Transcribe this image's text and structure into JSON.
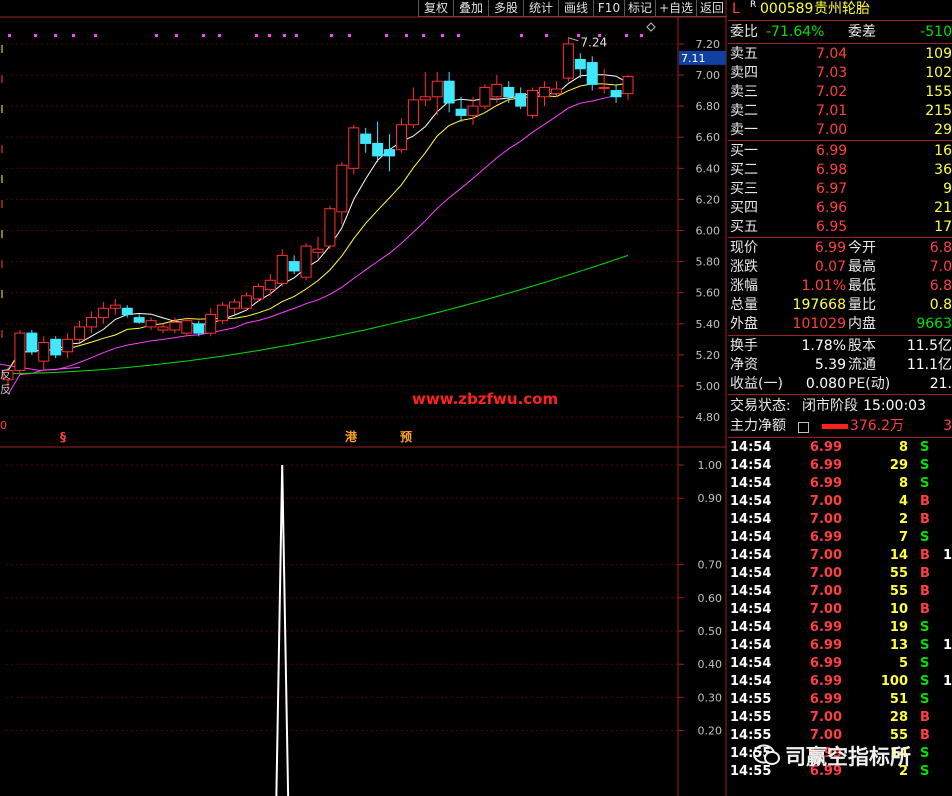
{
  "toolbar": {
    "buttons": [
      "复权",
      "叠加",
      "多股",
      "统计",
      "画线",
      "F10",
      "标记",
      "+自选",
      "返回"
    ]
  },
  "colors": {
    "up": "#ff3030",
    "down": "#40e8ff",
    "ma5": "#ffffff",
    "ma10": "#ffff40",
    "ma20": "#ff40ff",
    "ma60": "#00e000",
    "axis": "#a02020"
  },
  "price_chart": {
    "y_ticks": [
      "7.20",
      "7.00",
      "6.80",
      "6.60",
      "6.40",
      "6.20",
      "6.00",
      "5.80",
      "5.60",
      "5.40",
      "5.20",
      "5.00",
      "4.80"
    ],
    "current_price_tag": "7.11",
    "high_annotation": "7.24",
    "website": "www.zbzfwu.com",
    "markers": [
      "§",
      "港",
      "预"
    ],
    "left_labels": [
      "反",
      "反"
    ],
    "left_marker": "0"
  },
  "chart_data": [
    {
      "type": "candlestick",
      "title": "",
      "ylim": [
        4.7,
        7.3
      ],
      "candles": [
        {
          "o": 5.04,
          "h": 5.12,
          "l": 4.98,
          "c": 5.1
        },
        {
          "o": 5.1,
          "h": 5.36,
          "l": 5.08,
          "c": 5.34
        },
        {
          "o": 5.34,
          "h": 5.36,
          "l": 5.2,
          "c": 5.22
        },
        {
          "o": 5.16,
          "h": 5.32,
          "l": 5.1,
          "c": 5.28
        },
        {
          "o": 5.3,
          "h": 5.32,
          "l": 5.18,
          "c": 5.2
        },
        {
          "o": 5.22,
          "h": 5.34,
          "l": 5.18,
          "c": 5.3
        },
        {
          "o": 5.3,
          "h": 5.42,
          "l": 5.28,
          "c": 5.38
        },
        {
          "o": 5.38,
          "h": 5.48,
          "l": 5.34,
          "c": 5.44
        },
        {
          "o": 5.44,
          "h": 5.54,
          "l": 5.4,
          "c": 5.5
        },
        {
          "o": 5.5,
          "h": 5.56,
          "l": 5.46,
          "c": 5.52
        },
        {
          "o": 5.5,
          "h": 5.52,
          "l": 5.44,
          "c": 5.46
        },
        {
          "o": 5.44,
          "h": 5.46,
          "l": 5.4,
          "c": 5.41
        },
        {
          "o": 5.38,
          "h": 5.44,
          "l": 5.36,
          "c": 5.42
        },
        {
          "o": 5.36,
          "h": 5.4,
          "l": 5.34,
          "c": 5.38
        },
        {
          "o": 5.36,
          "h": 5.44,
          "l": 5.34,
          "c": 5.41
        },
        {
          "o": 5.34,
          "h": 5.44,
          "l": 5.32,
          "c": 5.42
        },
        {
          "o": 5.4,
          "h": 5.42,
          "l": 5.32,
          "c": 5.34
        },
        {
          "o": 5.34,
          "h": 5.5,
          "l": 5.32,
          "c": 5.46
        },
        {
          "o": 5.42,
          "h": 5.54,
          "l": 5.4,
          "c": 5.52
        },
        {
          "o": 5.5,
          "h": 5.56,
          "l": 5.46,
          "c": 5.54
        },
        {
          "o": 5.5,
          "h": 5.6,
          "l": 5.48,
          "c": 5.58
        },
        {
          "o": 5.56,
          "h": 5.66,
          "l": 5.54,
          "c": 5.64
        },
        {
          "o": 5.62,
          "h": 5.72,
          "l": 5.58,
          "c": 5.68
        },
        {
          "o": 5.66,
          "h": 5.88,
          "l": 5.64,
          "c": 5.84
        },
        {
          "o": 5.8,
          "h": 5.84,
          "l": 5.72,
          "c": 5.74
        },
        {
          "o": 5.7,
          "h": 5.92,
          "l": 5.68,
          "c": 5.9
        },
        {
          "o": 5.86,
          "h": 5.96,
          "l": 5.82,
          "c": 5.88
        },
        {
          "o": 5.9,
          "h": 6.16,
          "l": 5.88,
          "c": 6.14
        },
        {
          "o": 6.12,
          "h": 6.44,
          "l": 6.04,
          "c": 6.42
        },
        {
          "o": 6.4,
          "h": 6.68,
          "l": 6.36,
          "c": 6.66
        },
        {
          "o": 6.62,
          "h": 6.66,
          "l": 6.5,
          "c": 6.56
        },
        {
          "o": 6.56,
          "h": 6.7,
          "l": 6.44,
          "c": 6.48
        },
        {
          "o": 6.52,
          "h": 6.62,
          "l": 6.38,
          "c": 6.48
        },
        {
          "o": 6.52,
          "h": 6.72,
          "l": 6.5,
          "c": 6.68
        },
        {
          "o": 6.68,
          "h": 6.92,
          "l": 6.66,
          "c": 6.84
        },
        {
          "o": 6.84,
          "h": 7.02,
          "l": 6.8,
          "c": 6.86
        },
        {
          "o": 6.86,
          "h": 7.02,
          "l": 6.74,
          "c": 6.96
        },
        {
          "o": 6.96,
          "h": 7.02,
          "l": 6.76,
          "c": 6.82
        },
        {
          "o": 6.78,
          "h": 6.86,
          "l": 6.7,
          "c": 6.74
        },
        {
          "o": 6.74,
          "h": 6.86,
          "l": 6.68,
          "c": 6.8
        },
        {
          "o": 6.8,
          "h": 6.94,
          "l": 6.78,
          "c": 6.92
        },
        {
          "o": 6.86,
          "h": 7.0,
          "l": 6.82,
          "c": 6.94
        },
        {
          "o": 6.92,
          "h": 6.96,
          "l": 6.82,
          "c": 6.86
        },
        {
          "o": 6.88,
          "h": 6.92,
          "l": 6.78,
          "c": 6.8
        },
        {
          "o": 6.74,
          "h": 6.92,
          "l": 6.72,
          "c": 6.9
        },
        {
          "o": 6.86,
          "h": 6.96,
          "l": 6.8,
          "c": 6.92
        },
        {
          "o": 6.88,
          "h": 6.96,
          "l": 6.86,
          "c": 6.91
        },
        {
          "o": 6.98,
          "h": 7.24,
          "l": 6.96,
          "c": 7.2
        },
        {
          "o": 7.1,
          "h": 7.14,
          "l": 6.98,
          "c": 7.04
        },
        {
          "o": 7.08,
          "h": 7.12,
          "l": 6.9,
          "c": 6.94
        },
        {
          "o": 6.92,
          "h": 7.04,
          "l": 6.88,
          "c": 6.92
        },
        {
          "o": 6.9,
          "h": 6.94,
          "l": 6.82,
          "c": 6.86
        },
        {
          "o": 6.88,
          "h": 7.0,
          "l": 6.84,
          "c": 6.99
        }
      ]
    },
    {
      "type": "line",
      "title": "",
      "ylim": [
        0,
        1.05
      ],
      "y_ticks": [
        "1.00",
        "0.90",
        "0.70",
        "0.60",
        "0.50",
        "0.40",
        "0.30",
        "0.20"
      ],
      "x": [
        0,
        22.5,
        23,
        23.5,
        25.5
      ],
      "y": [
        0,
        0,
        1.0,
        0,
        0
      ]
    }
  ],
  "quote": {
    "header": {
      "market_l": "L",
      "market_r": "R",
      "code": "000589",
      "name": "贵州轮胎"
    },
    "ratio": {
      "label1": "委比",
      "value1": "-71.64%",
      "label2": "委差",
      "value2": "-510"
    },
    "sells": [
      {
        "label": "卖五",
        "price": "7.04",
        "vol": "109"
      },
      {
        "label": "卖四",
        "price": "7.03",
        "vol": "102"
      },
      {
        "label": "卖三",
        "price": "7.02",
        "vol": "155"
      },
      {
        "label": "卖二",
        "price": "7.01",
        "vol": "215"
      },
      {
        "label": "卖一",
        "price": "7.00",
        "vol": "29"
      }
    ],
    "buys": [
      {
        "label": "买一",
        "price": "6.99",
        "vol": "16"
      },
      {
        "label": "买二",
        "price": "6.98",
        "vol": "36"
      },
      {
        "label": "买三",
        "price": "6.97",
        "vol": "9"
      },
      {
        "label": "买四",
        "price": "6.96",
        "vol": "21"
      },
      {
        "label": "买五",
        "price": "6.95",
        "vol": "17"
      }
    ],
    "stats": [
      {
        "l1": "现价",
        "v1": "6.99",
        "c1": "red",
        "l2": "今开",
        "v2": "6.8",
        "c2": "red"
      },
      {
        "l1": "涨跌",
        "v1": "0.07",
        "c1": "red",
        "l2": "最高",
        "v2": "7.0",
        "c2": "red"
      },
      {
        "l1": "涨幅",
        "v1": "1.01%",
        "c1": "red",
        "l2": "最低",
        "v2": "6.8",
        "c2": "red"
      },
      {
        "l1": "总量",
        "v1": "197668",
        "c1": "yel",
        "l2": "量比",
        "v2": "0.8",
        "c2": "yel"
      },
      {
        "l1": "外盘",
        "v1": "101029",
        "c1": "red",
        "l2": "内盘",
        "v2": "9663",
        "c2": "green"
      }
    ],
    "stats2": [
      {
        "l1": "换手",
        "v1": "1.78%",
        "c1": "wht",
        "l2": "股本",
        "v2": "11.5亿",
        "c2": "wht"
      },
      {
        "l1": "净资",
        "v1": "5.39",
        "c1": "wht",
        "l2": "流通",
        "v2": "11.1亿",
        "c2": "wht"
      },
      {
        "l1": "收益(一)",
        "v1": "0.080",
        "c1": "wht",
        "l2": "PE(动)",
        "v2": "21.",
        "c2": "wht"
      }
    ],
    "trade_status": {
      "label": "交易状态:",
      "value": "闭市阶段",
      "time": "15:00:03"
    },
    "main_flow": {
      "label": "主力净额",
      "value": "376.2万",
      "extra": "3"
    },
    "ticks": [
      {
        "t": "14:54",
        "p": "6.99",
        "v": "8",
        "d": "S"
      },
      {
        "t": "14:54",
        "p": "6.99",
        "v": "29",
        "d": "S"
      },
      {
        "t": "14:54",
        "p": "6.99",
        "v": "8",
        "d": "S"
      },
      {
        "t": "14:54",
        "p": "7.00",
        "v": "4",
        "d": "B"
      },
      {
        "t": "14:54",
        "p": "7.00",
        "v": "2",
        "d": "B"
      },
      {
        "t": "14:54",
        "p": "6.99",
        "v": "7",
        "d": "S"
      },
      {
        "t": "14:54",
        "p": "7.00",
        "v": "14",
        "d": "B"
      },
      {
        "t": "14:54",
        "p": "7.00",
        "v": "55",
        "d": "B"
      },
      {
        "t": "14:54",
        "p": "7.00",
        "v": "55",
        "d": "B"
      },
      {
        "t": "14:54",
        "p": "7.00",
        "v": "10",
        "d": "B"
      },
      {
        "t": "14:54",
        "p": "6.99",
        "v": "19",
        "d": "S"
      },
      {
        "t": "14:54",
        "p": "6.99",
        "v": "13",
        "d": "S"
      },
      {
        "t": "14:54",
        "p": "6.99",
        "v": "5",
        "d": "S"
      },
      {
        "t": "14:54",
        "p": "6.99",
        "v": "100",
        "d": "S"
      },
      {
        "t": "14:55",
        "p": "6.99",
        "v": "51",
        "d": "S"
      },
      {
        "t": "14:55",
        "p": "7.00",
        "v": "28",
        "d": "B"
      },
      {
        "t": "14:55",
        "p": "7.00",
        "v": "55",
        "d": "B"
      },
      {
        "t": "14:55",
        "p": "6.99",
        "v": "14",
        "d": "S"
      },
      {
        "t": "14:55",
        "p": "6.99",
        "v": "2",
        "d": "S"
      }
    ],
    "tick_extra": [
      "",
      "",
      "",
      "",
      "",
      "",
      "1",
      "",
      "",
      "",
      "",
      "1",
      "",
      "1",
      "",
      "",
      "",
      "",
      ""
    ]
  },
  "watermark": {
    "text": "司赢空指标所",
    "icon": "wechat-icon"
  }
}
